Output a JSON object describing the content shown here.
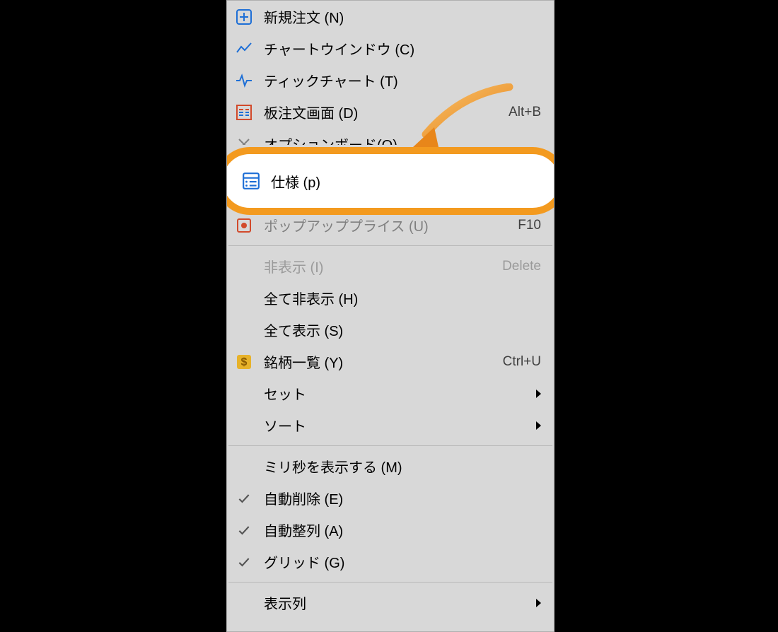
{
  "menu": {
    "new_order": {
      "label": "新規注文 (N)"
    },
    "chart_window": {
      "label": "チャートウインドウ (C)"
    },
    "tick_chart": {
      "label": "ティックチャート (T)"
    },
    "depth": {
      "label": "板注文画面 (D)",
      "shortcut": "Alt+B"
    },
    "option_board": {
      "label": "オプションボード(O)"
    },
    "spec": {
      "label": "仕様 (p)"
    },
    "popup_price": {
      "label": "ポップアッププライス (U)",
      "shortcut": "F10"
    },
    "hide": {
      "label": "非表示 (I)",
      "shortcut": "Delete"
    },
    "hide_all": {
      "label": "全て非表示 (H)"
    },
    "show_all": {
      "label": "全て表示 (S)"
    },
    "symbols": {
      "label": "銘柄一覧 (Y)",
      "shortcut": "Ctrl+U"
    },
    "set": {
      "label": "セット"
    },
    "sort": {
      "label": "ソート"
    },
    "show_ms": {
      "label": "ミリ秒を表示する (M)"
    },
    "auto_delete": {
      "label": "自動削除 (E)"
    },
    "auto_arrange": {
      "label": "自動整列 (A)"
    },
    "grid": {
      "label": "グリッド (G)"
    },
    "columns": {
      "label": "表示列"
    }
  }
}
